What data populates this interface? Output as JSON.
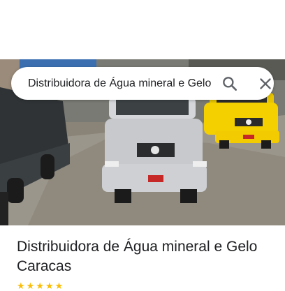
{
  "search": {
    "value": "Distribuidora de Água mineral e Gelo Caracas",
    "search_icon": "search-icon",
    "close_icon": "close-icon"
  },
  "place": {
    "title": "Distribuidora de Água mineral e Gelo Caracas",
    "stars_shown": 5,
    "star_color": "#fbbc04"
  },
  "colors": {
    "truck_main": "#c8c9cc",
    "truck_yellow": "#f5d000",
    "tarp": "#2f3335"
  }
}
